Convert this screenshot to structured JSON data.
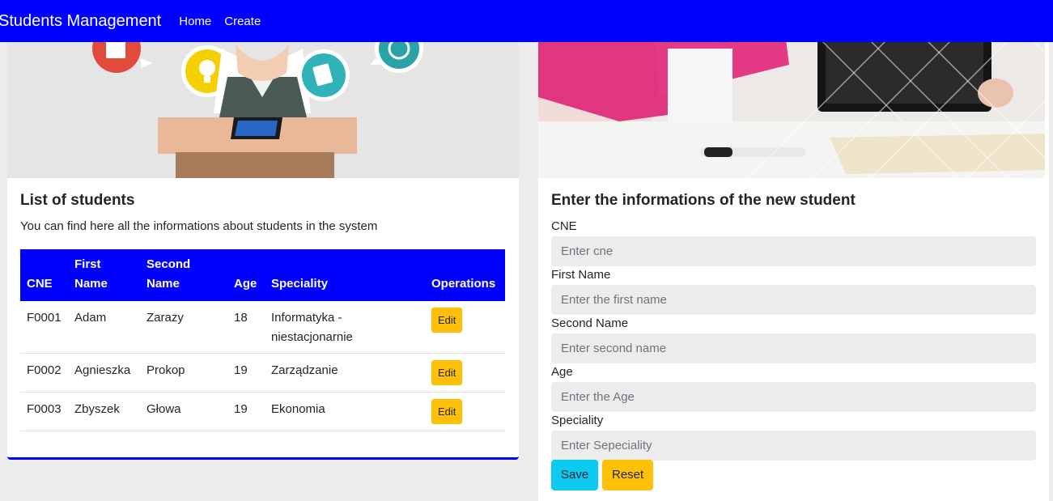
{
  "navbar": {
    "brand": "Students Management",
    "links": [
      "Home",
      "Create"
    ],
    "background": "#0000ff"
  },
  "list_card": {
    "title": "List of students",
    "description": "You can find here all the informations about students in the system",
    "table": {
      "headers": [
        "CNE",
        "First Name",
        "Second Name",
        "Age",
        "Speciality",
        "Operations"
      ],
      "rows": [
        {
          "cne": "F0001",
          "first_name": "Adam",
          "second_name": "Zarazy",
          "age": "18",
          "speciality": "Informatyka - niestacjonarnie",
          "action": "Edit"
        },
        {
          "cne": "F0002",
          "first_name": "Agnieszka",
          "second_name": "Prokop",
          "age": "19",
          "speciality": "Zarządzanie",
          "action": "Edit"
        },
        {
          "cne": "F0003",
          "first_name": "Zbyszek",
          "second_name": "Głowa",
          "age": "19",
          "speciality": "Ekonomia",
          "action": "Edit"
        }
      ]
    }
  },
  "form_card": {
    "title": "Enter the informations of the new student",
    "fields": [
      {
        "label": "CNE",
        "placeholder": "Enter cne"
      },
      {
        "label": "First Name",
        "placeholder": "Enter the first name"
      },
      {
        "label": "Second Name",
        "placeholder": "Enter second name"
      },
      {
        "label": "Age",
        "placeholder": "Enter the Age"
      },
      {
        "label": "Speciality",
        "placeholder": "Enter Sepeciality"
      }
    ],
    "save_label": "Save",
    "reset_label": "Reset"
  },
  "colors": {
    "accent": "#0000ff",
    "edit_button": "#ffc107",
    "save_button": "#0dcaf0",
    "reset_button": "#ffc107"
  }
}
